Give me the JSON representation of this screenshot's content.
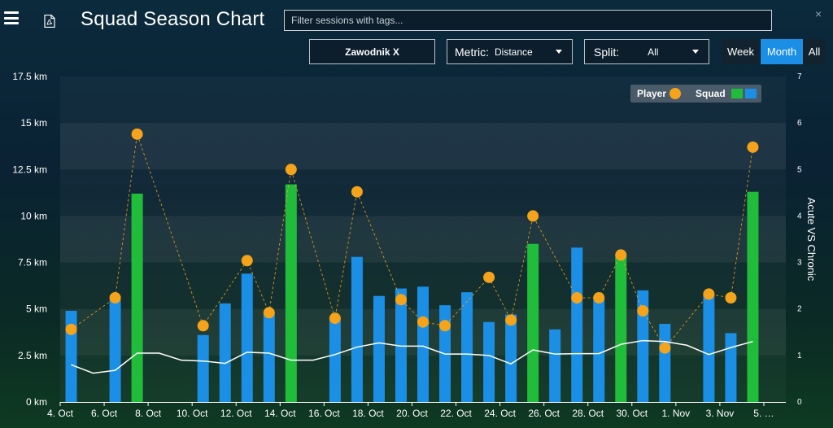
{
  "app": {
    "title": "Squad Season Chart",
    "filter_placeholder": "Filter sessions with tags...",
    "close_glyph": "×"
  },
  "controls": {
    "player": "Zawodnik X",
    "metric_label": "Metric:",
    "metric_value": "Distance",
    "split_label": "Split:",
    "split_value": "All",
    "periods": [
      "Week",
      "Month",
      "All"
    ],
    "active_period": "Month"
  },
  "colors": {
    "player": "#f5a31a",
    "squad_match": "#1fbd3a",
    "squad_training": "#1b8fe6",
    "acwr_line": "#ffffff"
  },
  "chart_data": {
    "type": "bar",
    "categories": [
      "4. Oct",
      "5. Oct",
      "6. Oct",
      "7. Oct",
      "8. Oct",
      "9. Oct",
      "10. Oct",
      "11. Oct",
      "12. Oct",
      "13. Oct",
      "14. Oct",
      "15. Oct",
      "16. Oct",
      "17. Oct",
      "18. Oct",
      "19. Oct",
      "20. Oct",
      "21. Oct",
      "22. Oct",
      "23. Oct",
      "24. Oct",
      "25. Oct",
      "26. Oct",
      "27. Oct",
      "28. Oct",
      "29. Oct",
      "30. Oct",
      "31. Oct",
      "1. Nov",
      "2. Nov",
      "3. Nov",
      "4. Nov",
      "5. Nov"
    ],
    "x_tick_labels": [
      "4. Oct",
      "6. Oct",
      "8. Oct",
      "10. Oct",
      "12. Oct",
      "14. Oct",
      "16. Oct",
      "18. Oct",
      "20. Oct",
      "22. Oct",
      "24. Oct",
      "26. Oct",
      "28. Oct",
      "30. Oct",
      "1. Nov",
      "3. Nov",
      "5. …"
    ],
    "y_left": {
      "ticks": [
        "0 km",
        "2.5 km",
        "5 km",
        "7.5 km",
        "10 km",
        "12.5 km",
        "15 km",
        "17.5 km"
      ],
      "ylim": [
        0,
        17.5
      ]
    },
    "y_right": {
      "label": "Acute VS Chronic",
      "ticks": [
        "0",
        "1",
        "2",
        "3",
        "4",
        "5",
        "6",
        "7"
      ],
      "ylim": [
        0,
        7
      ]
    },
    "legend": {
      "player_label": "Player",
      "squad_label": "Squad",
      "position": "top-right"
    },
    "squad": [
      {
        "x": "4. Oct",
        "value": 4.9,
        "type": "training"
      },
      {
        "x": "6. Oct",
        "value": 5.5,
        "type": "training"
      },
      {
        "x": "7. Oct",
        "value": 11.2,
        "type": "match"
      },
      {
        "x": "10. Oct",
        "value": 3.6,
        "type": "training"
      },
      {
        "x": "11. Oct",
        "value": 5.3,
        "type": "training"
      },
      {
        "x": "12. Oct",
        "value": 6.9,
        "type": "training"
      },
      {
        "x": "13. Oct",
        "value": 4.8,
        "type": "training"
      },
      {
        "x": "14. Oct",
        "value": 11.7,
        "type": "match"
      },
      {
        "x": "16. Oct",
        "value": 4.5,
        "type": "training"
      },
      {
        "x": "17. Oct",
        "value": 7.8,
        "type": "training"
      },
      {
        "x": "18. Oct",
        "value": 5.7,
        "type": "training"
      },
      {
        "x": "19. Oct",
        "value": 6.1,
        "type": "training"
      },
      {
        "x": "20. Oct",
        "value": 6.2,
        "type": "training"
      },
      {
        "x": "21. Oct",
        "value": 5.2,
        "type": "training"
      },
      {
        "x": "22. Oct",
        "value": 5.9,
        "type": "training"
      },
      {
        "x": "23. Oct",
        "value": 4.3,
        "type": "training"
      },
      {
        "x": "24. Oct",
        "value": 4.7,
        "type": "training"
      },
      {
        "x": "25. Oct",
        "value": 8.5,
        "type": "match"
      },
      {
        "x": "26. Oct",
        "value": 3.9,
        "type": "training"
      },
      {
        "x": "27. Oct",
        "value": 8.3,
        "type": "training"
      },
      {
        "x": "28. Oct",
        "value": 5.5,
        "type": "training"
      },
      {
        "x": "29. Oct",
        "value": 7.9,
        "type": "match"
      },
      {
        "x": "30. Oct",
        "value": 6.0,
        "type": "training"
      },
      {
        "x": "31. Oct",
        "value": 4.2,
        "type": "training"
      },
      {
        "x": "2. Nov",
        "value": 5.8,
        "type": "training"
      },
      {
        "x": "3. Nov",
        "value": 3.7,
        "type": "training"
      },
      {
        "x": "4. Nov",
        "value": 11.3,
        "type": "match"
      }
    ],
    "player": [
      {
        "x": "4. Oct",
        "value": 3.9
      },
      {
        "x": "6. Oct",
        "value": 5.6
      },
      {
        "x": "7. Oct",
        "value": 14.4
      },
      {
        "x": "10. Oct",
        "value": 4.1
      },
      {
        "x": "12. Oct",
        "value": 7.6
      },
      {
        "x": "13. Oct",
        "value": 4.8
      },
      {
        "x": "14. Oct",
        "value": 12.5
      },
      {
        "x": "16. Oct",
        "value": 4.5
      },
      {
        "x": "17. Oct",
        "value": 11.3
      },
      {
        "x": "19. Oct",
        "value": 5.5
      },
      {
        "x": "20. Oct",
        "value": 4.3
      },
      {
        "x": "21. Oct",
        "value": 4.1
      },
      {
        "x": "23. Oct",
        "value": 6.7
      },
      {
        "x": "24. Oct",
        "value": 4.4
      },
      {
        "x": "25. Oct",
        "value": 10.0
      },
      {
        "x": "27. Oct",
        "value": 5.6
      },
      {
        "x": "28. Oct",
        "value": 5.6
      },
      {
        "x": "29. Oct",
        "value": 7.9
      },
      {
        "x": "30. Oct",
        "value": 4.9
      },
      {
        "x": "31. Oct",
        "value": 2.9
      },
      {
        "x": "2. Nov",
        "value": 5.8
      },
      {
        "x": "3. Nov",
        "value": 5.6
      },
      {
        "x": "4. Nov",
        "value": 13.7
      }
    ],
    "acute_vs_chronic": [
      {
        "x": "4. Oct",
        "value": 0.8
      },
      {
        "x": "5. Oct",
        "value": 0.62
      },
      {
        "x": "6. Oct",
        "value": 0.68
      },
      {
        "x": "7. Oct",
        "value": 1.05
      },
      {
        "x": "8. Oct",
        "value": 1.05
      },
      {
        "x": "9. Oct",
        "value": 0.9
      },
      {
        "x": "10. Oct",
        "value": 0.88
      },
      {
        "x": "11. Oct",
        "value": 0.83
      },
      {
        "x": "12. Oct",
        "value": 1.07
      },
      {
        "x": "13. Oct",
        "value": 1.05
      },
      {
        "x": "14. Oct",
        "value": 0.9
      },
      {
        "x": "15. Oct",
        "value": 0.9
      },
      {
        "x": "16. Oct",
        "value": 1.02
      },
      {
        "x": "17. Oct",
        "value": 1.18
      },
      {
        "x": "18. Oct",
        "value": 1.27
      },
      {
        "x": "19. Oct",
        "value": 1.2
      },
      {
        "x": "20. Oct",
        "value": 1.2
      },
      {
        "x": "21. Oct",
        "value": 1.03
      },
      {
        "x": "22. Oct",
        "value": 1.03
      },
      {
        "x": "23. Oct",
        "value": 1.0
      },
      {
        "x": "24. Oct",
        "value": 0.82
      },
      {
        "x": "25. Oct",
        "value": 1.12
      },
      {
        "x": "26. Oct",
        "value": 1.03
      },
      {
        "x": "27. Oct",
        "value": 1.04
      },
      {
        "x": "28. Oct",
        "value": 1.04
      },
      {
        "x": "29. Oct",
        "value": 1.24
      },
      {
        "x": "30. Oct",
        "value": 1.32
      },
      {
        "x": "31. Oct",
        "value": 1.3
      },
      {
        "x": "1. Nov",
        "value": 1.22
      },
      {
        "x": "2. Nov",
        "value": 1.02
      },
      {
        "x": "3. Nov",
        "value": 1.17
      },
      {
        "x": "4. Nov",
        "value": 1.3
      }
    ]
  }
}
